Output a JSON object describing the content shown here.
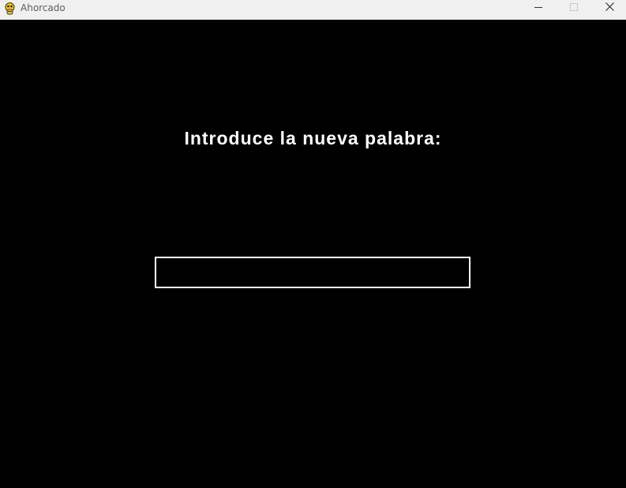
{
  "window": {
    "title": "Ahorcado",
    "icon": "pygame-snake-icon",
    "controls": [
      "minimize-icon",
      "maximize-icon",
      "close-icon"
    ]
  },
  "game": {
    "prompt": "Introduce la nueva palabra:",
    "word_input": {
      "value": "",
      "placeholder": ""
    }
  },
  "colors": {
    "background": "#000000",
    "text": "#ffffff",
    "input_border": "#ffffff",
    "titlebar": "#f0f0f0"
  }
}
